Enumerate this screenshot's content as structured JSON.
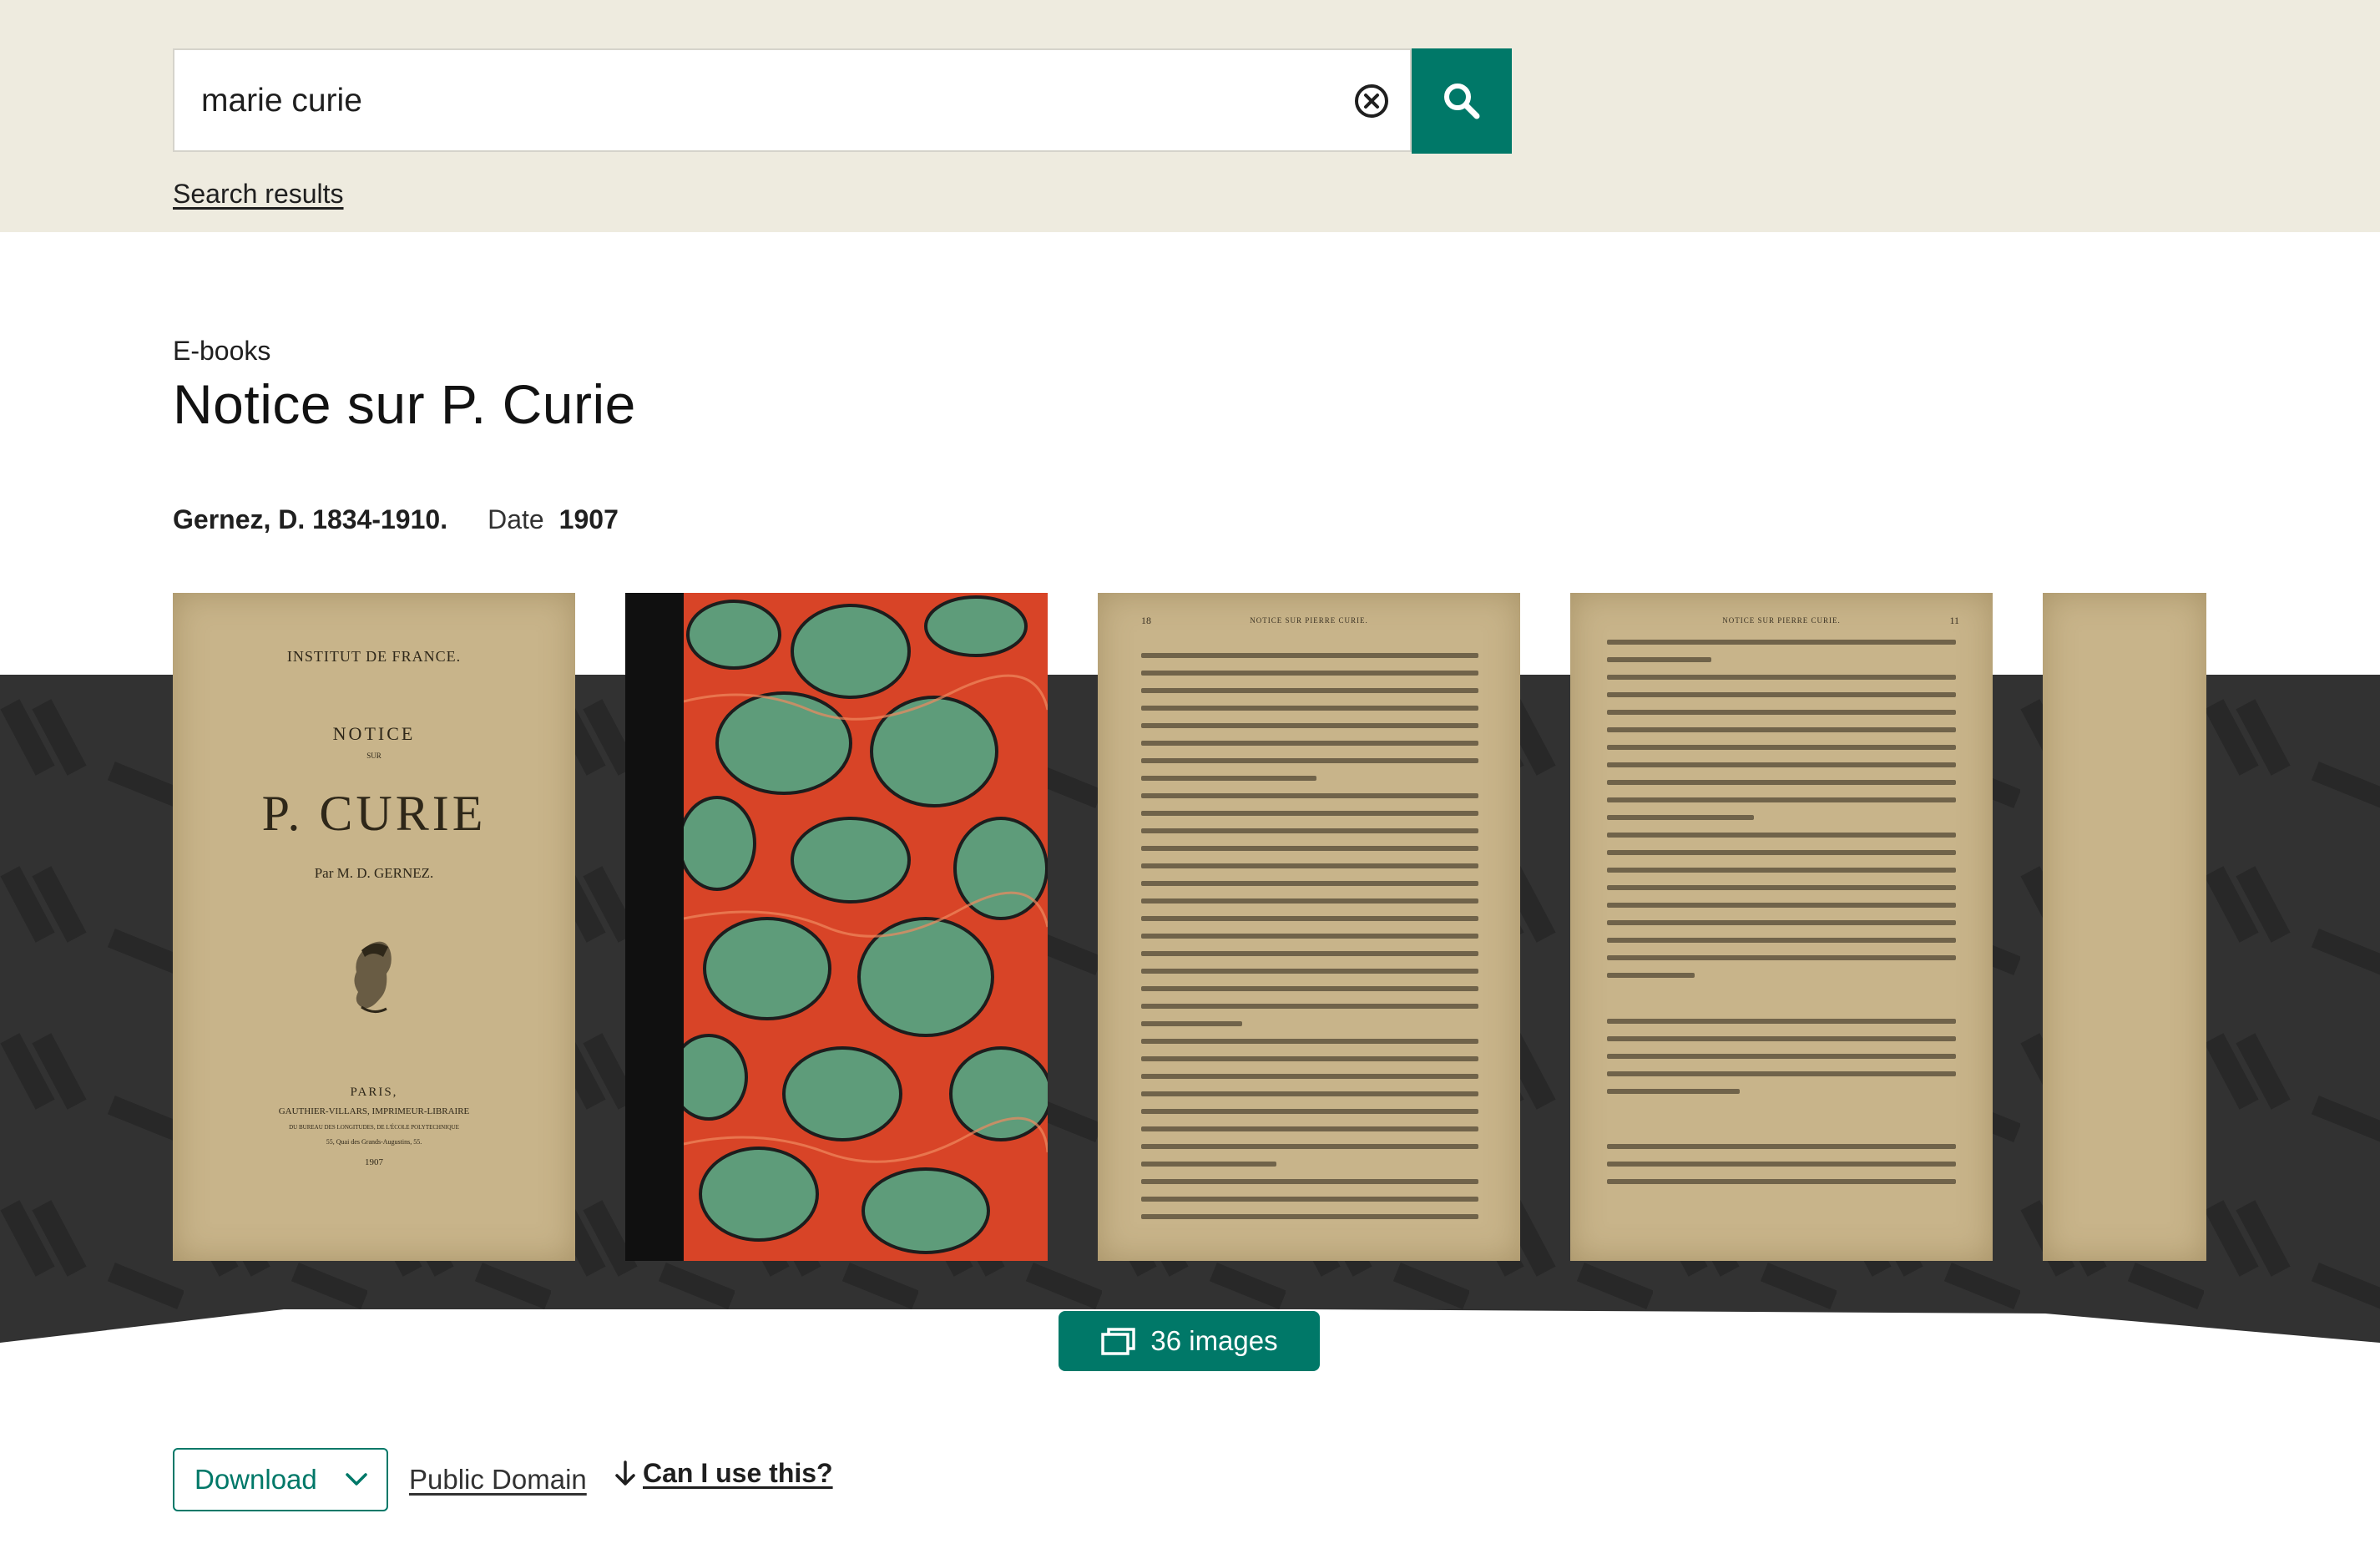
{
  "search": {
    "value": "marie curie"
  },
  "breadcrumb": {
    "label": "Search results"
  },
  "work": {
    "format": "E-books",
    "title": "Notice sur P. Curie",
    "author": "Gernez, D. 1834-1910.",
    "date_label": "Date",
    "date_value": "1907"
  },
  "cover": {
    "institution": "INSTITUT DE FRANCE.",
    "notice": "NOTICE",
    "sur": "SUR",
    "subject": "P. CURIE",
    "byline": "Par M. D. GERNEZ.",
    "city": "PARIS,",
    "publisher": "GAUTHIER-VILLARS, IMPRIMEUR-LIBRAIRE",
    "publisher_line2": "DU BUREAU DES LONGITUDES, DE L'ÉCOLE POLYTECHNIQUE",
    "address": "55, Quai des Grands-Augustins, 55.",
    "year": "1907"
  },
  "pages": {
    "p1_number": "18",
    "p1_header": "NOTICE SUR PIERRE CURIE.",
    "p2_header": "NOTICE SUR PIERRE CURIE.",
    "p2_number": "11"
  },
  "viewer": {
    "images_label": "36 images"
  },
  "actions": {
    "download_label": "Download",
    "license_label": "Public Domain",
    "usage_label": "Can I use this?"
  },
  "colors": {
    "accent": "#007868",
    "search_band": "#eeebdf",
    "viewer_band": "#323232"
  },
  "icons": {
    "clear": "circle-x-icon",
    "search": "magnifier-icon",
    "images": "stacked-images-icon",
    "download": "chevron-down-icon",
    "usage": "arrow-down-icon"
  }
}
